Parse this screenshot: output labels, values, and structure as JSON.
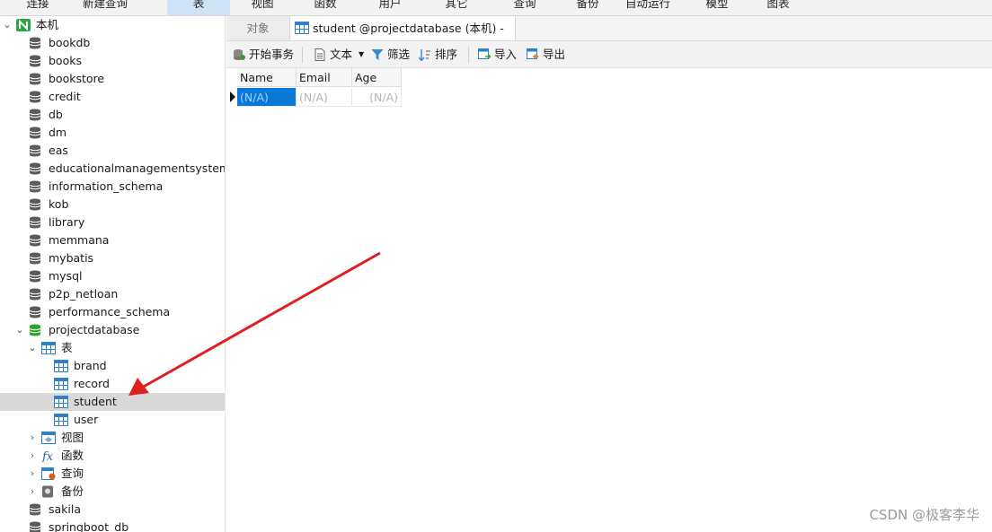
{
  "menu": {
    "items": [
      "连接",
      "新建查询",
      "表",
      "视图",
      "函数",
      "用户",
      "其它",
      "查询",
      "备份",
      "自动运行",
      "模型",
      "图表"
    ],
    "active": "表"
  },
  "sidebar": {
    "connection": "本机",
    "databases": [
      "bookdb",
      "books",
      "bookstore",
      "credit",
      "db",
      "dm",
      "eas",
      "educationalmanagementsystem",
      "information_schema",
      "kob",
      "library",
      "memmana",
      "mybatis",
      "mysql",
      "p2p_netloan",
      "performance_schema"
    ],
    "open_database": "projectdatabase",
    "tables_label": "表",
    "tables": [
      "brand",
      "record",
      "student",
      "user"
    ],
    "selected_table": "student",
    "groups": [
      "视图",
      "函数",
      "查询",
      "备份"
    ],
    "more_databases": [
      "sakila",
      "springboot_db"
    ]
  },
  "tabs": {
    "objects": "对象",
    "active_tab": "student @projectdatabase (本机) - 表"
  },
  "toolbar": {
    "begin_transaction": "开始事务",
    "text": "文本",
    "filter": "筛选",
    "sort": "排序",
    "import": "导入",
    "export": "导出"
  },
  "grid": {
    "columns": [
      "Name",
      "Email",
      "Age"
    ],
    "rows": [
      [
        "(N/A)",
        "(N/A)",
        "(N/A)"
      ]
    ]
  },
  "watermark": "CSDN @极客李华",
  "colors": {
    "accent": "#0a78d7",
    "selection_row": "#d9d9d9",
    "arrow": "#e02020",
    "db_icon": "#5a5a5a",
    "db_icon_open": "#2aa52a",
    "table_icon": "#2f7fc9"
  }
}
